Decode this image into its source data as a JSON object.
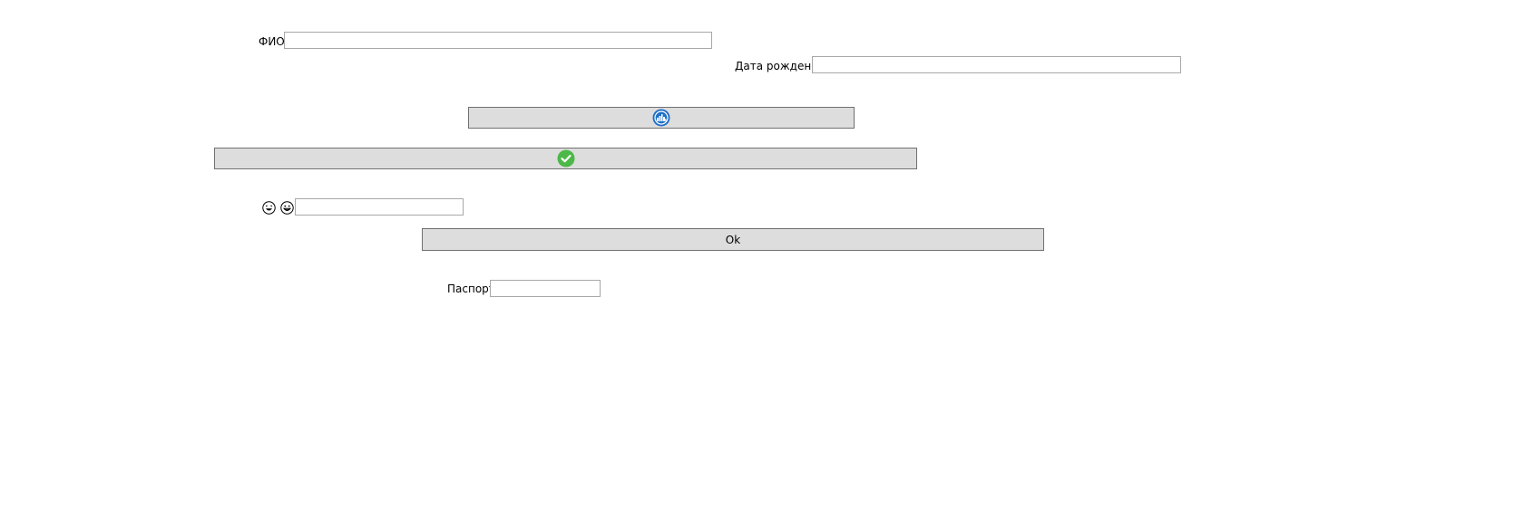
{
  "form": {
    "fio": {
      "label": "ФИО",
      "value": "",
      "placeholder": ""
    },
    "birth_date": {
      "label": "Дата рождения",
      "value": "",
      "placeholder": ""
    },
    "image_button_1": {
      "icon": "city-badge-icon",
      "label": ""
    },
    "image_button_2": {
      "icon": "check-circle-icon",
      "label": ""
    },
    "emoji_field": {
      "icons": [
        "laughing-face-icon",
        "grinning-face-icon"
      ],
      "value": "",
      "placeholder": ""
    },
    "ok_button": {
      "label": "Ok"
    },
    "passport": {
      "label": "Паспорт",
      "value": "",
      "placeholder": ""
    }
  },
  "colors": {
    "button_bg": "#dddddd",
    "button_border": "#707070",
    "field_border": "#a8a8a8",
    "city_icon_blue": "#1f6fc6",
    "check_icon_green": "#4cb848"
  }
}
